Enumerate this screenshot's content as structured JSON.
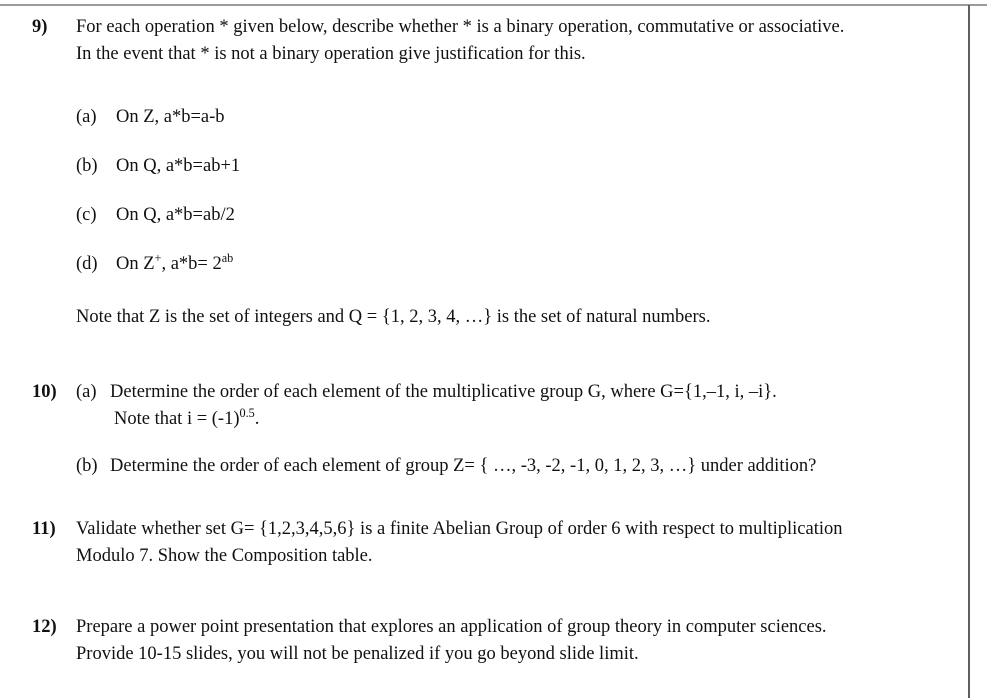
{
  "document": {
    "type": "assignment-questions",
    "font_color": "#111111",
    "rule_color": "#9a9a9a",
    "border_color": "#5f5f5f"
  },
  "questions": [
    {
      "number": "9)",
      "intro_line_1": "For each operation * given below, describe whether * is a binary operation, commutative or associative.",
      "intro_line_2": "In the event that * is not a binary operation give justification for this.",
      "subitems": [
        {
          "letter": "(a)",
          "text": "On Z, a*b=a-b"
        },
        {
          "letter": "(b)",
          "text": "On Q, a*b=ab+1"
        },
        {
          "letter": "(c)",
          "text": "On Q, a*b=ab/2"
        },
        {
          "letter": "(d)",
          "text_before": "On Z",
          "sup_1": "+",
          "text_mid": ", a*b= 2",
          "sup_2": "ab"
        }
      ],
      "note": "Note that Z is the set of integers and Q = {1, 2, 3, 4, …} is the set of natural numbers."
    },
    {
      "number": "10)",
      "part_a_letter": "(a)",
      "part_a_text": "Determine the order of each element of the multiplicative group G, where G={1,–1, i, –i}.",
      "part_a_note_before": "Note that i = (-1)",
      "part_a_note_sup": "0.5",
      "part_a_note_after": ".",
      "part_b_letter": "(b)",
      "part_b_text": "Determine the order of each element of group Z= { …, -3, -2, -1, 0, 1, 2, 3, …} under addition?"
    },
    {
      "number": "11)",
      "line_1": "Validate whether set G= {1,2,3,4,5,6} is a finite Abelian Group of order 6 with respect to multiplication",
      "line_2": "Modulo 7. Show the Composition table."
    },
    {
      "number": "12)",
      "line_1": "Prepare a power point presentation that explores an application of group theory in computer sciences.",
      "line_2": "Provide 10-15 slides, you will not be penalized if you go beyond slide limit."
    }
  ]
}
